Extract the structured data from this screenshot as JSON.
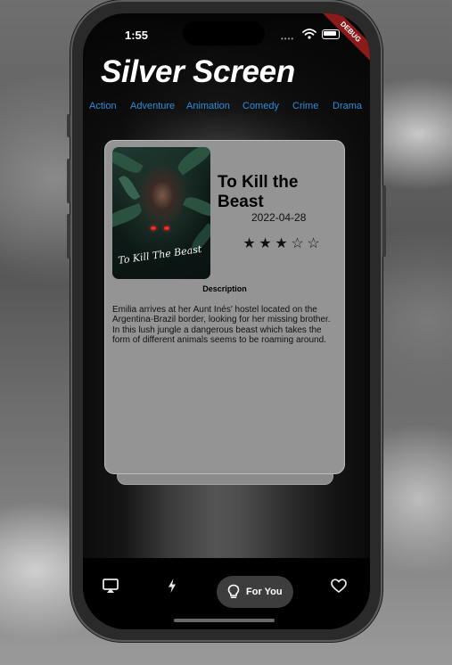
{
  "status": {
    "time": "1:55",
    "debug_banner": "DEBUG"
  },
  "app": {
    "title": "Silver Screen"
  },
  "genres": [
    "Action",
    "Adventure",
    "Animation",
    "Comedy",
    "Crime",
    "Drama"
  ],
  "movie": {
    "poster_text": "To Kill The Beast",
    "title": "To Kill the Beast",
    "release_date": "2022-04-28",
    "rating": {
      "value": 3,
      "max": 5
    },
    "stars": [
      "★",
      "★",
      "★",
      "☆",
      "☆"
    ],
    "description_label": "Description",
    "description": "Emilia arrives at her Aunt Inés' hostel located on the Argentina-Brazil border, looking for her missing brother. In this lush jungle a dangerous beast which takes the form of different animals seems to be roaming around."
  },
  "nav": {
    "items": [
      {
        "icon": "cast-icon"
      },
      {
        "icon": "lightning-icon"
      },
      {
        "icon": "lightbulb-icon",
        "label": "For You",
        "selected": true
      },
      {
        "icon": "heart-icon"
      }
    ],
    "selected_label": "For You"
  },
  "colors": {
    "genre_link": "#2f8cd8",
    "debug_banner": "#8b1a1a",
    "card": "#949494",
    "selected_pill": "#3d3d3d"
  }
}
